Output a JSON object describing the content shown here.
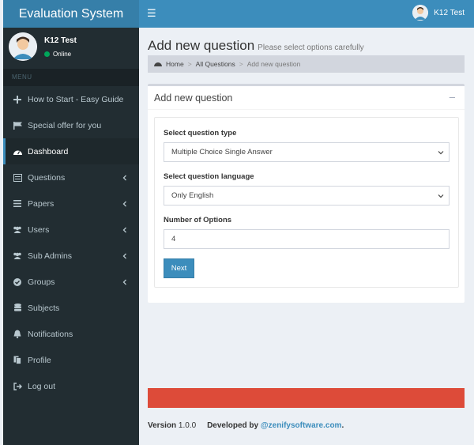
{
  "app": {
    "title": "Evaluation System"
  },
  "navbar": {
    "user_name": "K12 Test"
  },
  "sidebar": {
    "user_name": "K12 Test",
    "status": "Online",
    "menu_header": "MENU",
    "items": [
      {
        "label": "How to Start - Easy Guide",
        "icon": "plus-icon",
        "chevron": false,
        "active": false
      },
      {
        "label": "Special offer for you",
        "icon": "flag-icon",
        "chevron": false,
        "active": false
      },
      {
        "label": "Dashboard",
        "icon": "dashboard-icon",
        "chevron": false,
        "active": true
      },
      {
        "label": "Questions",
        "icon": "list-alt-icon",
        "chevron": true,
        "active": false
      },
      {
        "label": "Papers",
        "icon": "list-icon",
        "chevron": true,
        "active": false
      },
      {
        "label": "Users",
        "icon": "users-icon",
        "chevron": true,
        "active": false
      },
      {
        "label": "Sub Admins",
        "icon": "users-icon",
        "chevron": true,
        "active": false
      },
      {
        "label": "Groups",
        "icon": "check-circle-icon",
        "chevron": true,
        "active": false
      },
      {
        "label": "Subjects",
        "icon": "database-icon",
        "chevron": false,
        "active": false
      },
      {
        "label": "Notifications",
        "icon": "bell-icon",
        "chevron": false,
        "active": false
      },
      {
        "label": "Profile",
        "icon": "copy-icon",
        "chevron": false,
        "active": false
      },
      {
        "label": "Log out",
        "icon": "sign-out-icon",
        "chevron": false,
        "active": false
      }
    ]
  },
  "header": {
    "title": "Add new question",
    "subtitle": "Please select options carefully",
    "breadcrumb": [
      "Home",
      "All Questions",
      "Add new question"
    ]
  },
  "box": {
    "title": "Add new question",
    "question_type_label": "Select question type",
    "question_type_value": "Multiple Choice Single Answer",
    "language_label": "Select question language",
    "language_value": "Only English",
    "options_label": "Number of Options",
    "options_value": "4",
    "next_label": "Next"
  },
  "footer": {
    "version_label": "Version",
    "version_value": "1.0.0",
    "developed_by": "Developed by",
    "link": "@zenifysoftware.com",
    "period": "."
  },
  "colors": {
    "header": "#3c8dbc",
    "logo": "#367fa9",
    "sidebar": "#222d32",
    "alert": "#dd4b39"
  }
}
